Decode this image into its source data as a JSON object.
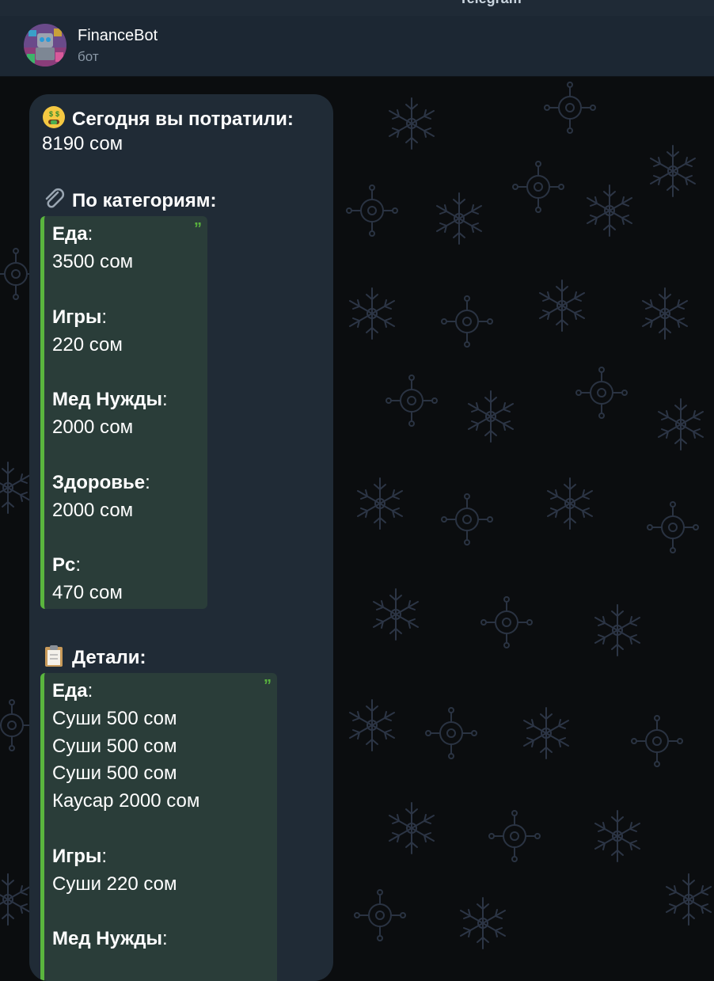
{
  "app": {
    "title": "Telegram"
  },
  "chat": {
    "name": "FinanceBot",
    "subtitle": "бот"
  },
  "message": {
    "today_heading": "Сегодня вы потратили:",
    "today_total": "8190 сом",
    "categories_heading": "По категориям:",
    "categories": [
      {
        "name": "Еда",
        "amount": "3500 сом"
      },
      {
        "name": "Игры",
        "amount": "220 сом"
      },
      {
        "name": "Мед Нужды",
        "amount": "2000 сом"
      },
      {
        "name": "Здоровье",
        "amount": "2000 сом"
      },
      {
        "name": "Pc",
        "amount": "470 сом"
      }
    ],
    "details_heading": "Детали:",
    "details": [
      {
        "name": "Еда",
        "items": [
          "Суши 500 сом",
          "Суши 500 сом",
          "Суши 500 сом",
          "Каусар 2000 сом"
        ]
      },
      {
        "name": "Игры",
        "items": [
          "Суши 220 сом"
        ]
      },
      {
        "name": "Мед Нужды",
        "items": []
      }
    ]
  },
  "icons": {
    "money_face": "money-mouth-face-icon",
    "paperclip": "paperclip-icon",
    "clipboard": "clipboard-icon",
    "quote": "quote-mark-icon"
  },
  "colors": {
    "bubble": "#202b36",
    "quote_bg": "#2a3d39",
    "quote_accent": "#5ab53e",
    "header": "#1c2733"
  }
}
